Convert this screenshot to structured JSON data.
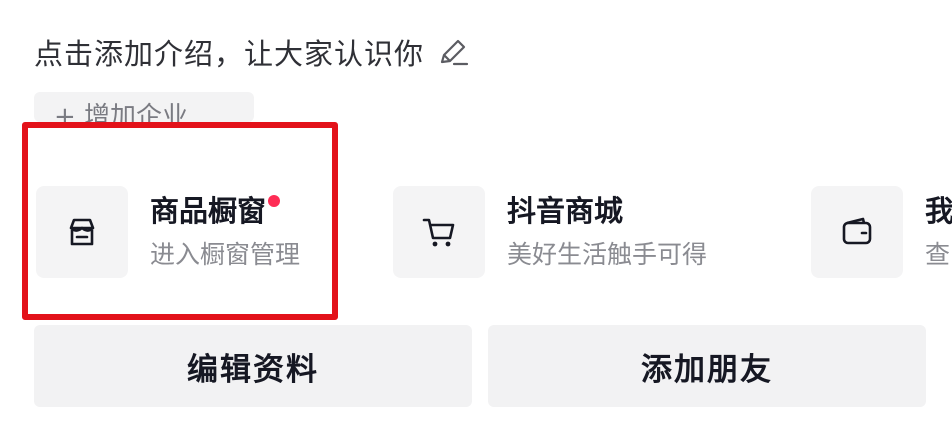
{
  "profile": {
    "intro_text": "点击添加介绍，让大家认识你",
    "add_company_label": "+ 增加企业"
  },
  "shortcuts": [
    {
      "title": "商品橱窗",
      "subtitle": "进入橱窗管理",
      "icon": "storefront-icon",
      "has_dot": true
    },
    {
      "title": "抖音商城",
      "subtitle": "美好生活触手可得",
      "icon": "shopping-cart-icon",
      "has_dot": false
    },
    {
      "title": "我",
      "subtitle": "查",
      "icon": "wallet-icon",
      "has_dot": false
    }
  ],
  "actions": {
    "edit_profile": "编辑资料",
    "add_friend": "添加朋友"
  },
  "colors": {
    "highlight": "#e3121a",
    "dot": "#fe2c55",
    "button_bg": "#f2f2f3",
    "icon_bg": "#f4f4f5"
  }
}
